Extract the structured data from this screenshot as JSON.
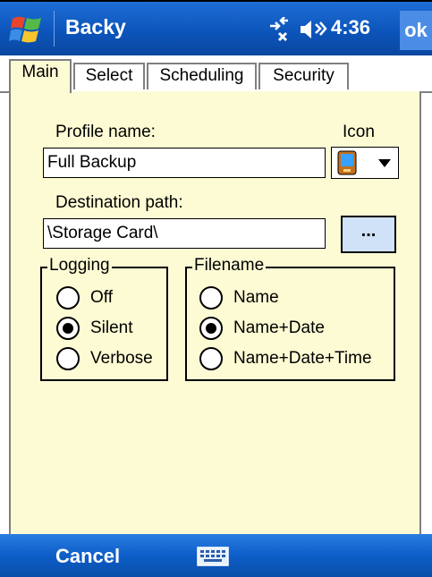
{
  "window": {
    "title": "Backy",
    "time": "4:36",
    "ok_label": "ok"
  },
  "tabs": [
    {
      "label": "Main",
      "active": true
    },
    {
      "label": "Select",
      "active": false
    },
    {
      "label": "Scheduling",
      "active": false
    },
    {
      "label": "Security",
      "active": false
    }
  ],
  "form": {
    "profile_name_label": "Profile name:",
    "profile_name_value": "Full Backup",
    "icon_label": "Icon",
    "destination_label": "Destination path:",
    "destination_value": "\\Storage Card\\",
    "browse_label": "..."
  },
  "logging": {
    "title": "Logging",
    "options": [
      "Off",
      "Silent",
      "Verbose"
    ],
    "selected": "Silent"
  },
  "filename": {
    "title": "Filename",
    "options": [
      "Name",
      "Name+Date",
      "Name+Date+Time"
    ],
    "selected": "Name+Date"
  },
  "bottombar": {
    "cancel_label": "Cancel"
  },
  "icons": {
    "start": "windows-flag-icon",
    "connectivity": "connectivity-icon",
    "volume": "volume-icon",
    "profile": "pda-icon",
    "keyboard": "keyboard-icon"
  },
  "colors": {
    "titlebar": "#0c55bb",
    "content_bg": "#fdfbd4",
    "button_bg": "#cfe2f8"
  }
}
